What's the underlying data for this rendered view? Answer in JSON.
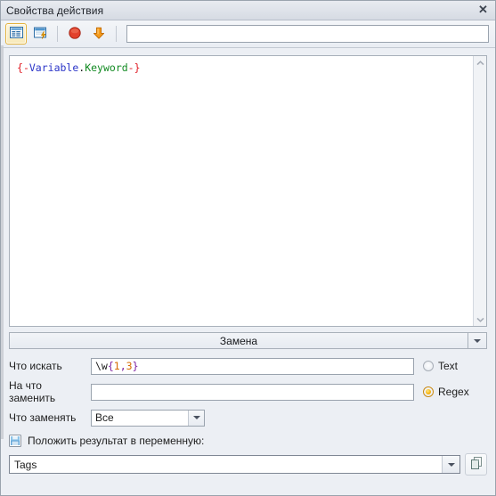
{
  "window": {
    "title": "Свойства действия",
    "close_label": "✕"
  },
  "toolbar": {
    "buttons": [
      {
        "name": "table-view-icon",
        "title": ""
      },
      {
        "name": "window-script-icon",
        "title": ""
      },
      {
        "name": "stop-circle-icon",
        "title": ""
      },
      {
        "name": "down-arrow-icon",
        "title": ""
      }
    ],
    "search_value": "",
    "search_placeholder": ""
  },
  "editor": {
    "code_tokens": [
      {
        "text": "{",
        "type": "brace"
      },
      {
        "text": "-",
        "type": "dash"
      },
      {
        "text": "Variable",
        "type": "var"
      },
      {
        "text": ".",
        "type": "dot"
      },
      {
        "text": "Keyword",
        "type": "kw"
      },
      {
        "text": "-",
        "type": "dash"
      },
      {
        "text": "}",
        "type": "brace"
      }
    ],
    "code_text": "{-Variable.Keyword-}",
    "scroll_up": "▲",
    "scroll_down": "▼"
  },
  "replace_bar": {
    "label": "Замена"
  },
  "form": {
    "search_label": "Что искать",
    "search_value": "\\w{1,3}",
    "search_tokens": [
      {
        "text": "\\w",
        "type": "plain"
      },
      {
        "text": "{",
        "type": "meta"
      },
      {
        "text": "1",
        "type": "num"
      },
      {
        "text": ",",
        "type": "meta"
      },
      {
        "text": "3",
        "type": "num"
      },
      {
        "text": "}",
        "type": "meta"
      }
    ],
    "replace_label": "На что заменить",
    "replace_value": "",
    "mode_text_label": "Text",
    "mode_regex_label": "Regex",
    "mode_selected": "Regex",
    "scope_label": "Что заменять",
    "scope_value": "Все",
    "store_checkbox_label": "Положить результат в переменную:",
    "store_checkbox_checked": true,
    "variable_value": "Tags"
  },
  "colors": {
    "accent_selected": "#f7b20a",
    "toolbar_active_border": "#e3b23c",
    "token_red": "#e01b24",
    "token_blue": "#2b35c8",
    "token_green": "#128a22",
    "regex_meta": "#7d1fa0",
    "regex_num": "#d66b00"
  }
}
